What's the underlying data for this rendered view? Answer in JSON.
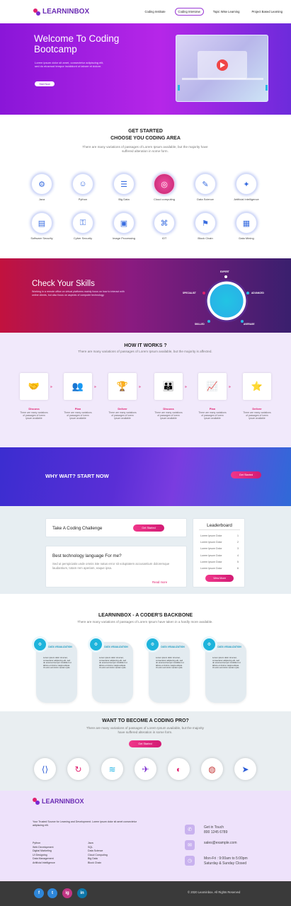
{
  "brand": {
    "name": "LEARNINBOX",
    "accent": "#9b2ee0",
    "pink": "#e0206f"
  },
  "nav": {
    "items": [
      "Coding Institute",
      "Coding Interview",
      "Topic Wise Learning",
      "Project Based Learning"
    ],
    "active_index": 1
  },
  "hero": {
    "title": "Welcome To Coding Bootcamp",
    "text": "Lorem ipsum dolor sit amet, consectetur adipiscing elit, sed do eiusmod tempor incididunt ut labore et dolore.",
    "button": "Start Now"
  },
  "get_started": {
    "title": "GET STARTED",
    "subtitle": "CHOOSE YOU CODING AREA",
    "desc": "There are many variations of passages of Lorem Ipsum available, but the majority have suffered alteration in some form.",
    "areas": [
      {
        "label": "Java",
        "icon": "brain-chip-icon"
      },
      {
        "label": "Python",
        "icon": "person-icon"
      },
      {
        "label": "Big Data",
        "icon": "database-icon"
      },
      {
        "label": "Cloud computing",
        "icon": "target-icon"
      },
      {
        "label": "Data Science",
        "icon": "blueprint-icon"
      },
      {
        "label": "Artificial Intelligence",
        "icon": "ai-head-icon"
      },
      {
        "label": "Software Security",
        "icon": "document-icon"
      },
      {
        "label": "Cyber Security",
        "icon": "user-lock-icon"
      },
      {
        "label": "Image Processing",
        "icon": "briefcase-icon"
      },
      {
        "label": "IOT",
        "icon": "circuit-icon"
      },
      {
        "label": "Block Chain",
        "icon": "network-icon"
      },
      {
        "label": "Data Mining",
        "icon": "folders-icon"
      }
    ]
  },
  "skills": {
    "title": "Check Your Skills",
    "text": "Working in a remote office on virtual platforms mainly focus on how to interact with online clients, but also focus on aspects of computer technology.",
    "dial_labels": [
      "EXPERT",
      "SPECIALIST",
      "ADVANCED",
      "SKILLED",
      "AVERAGE"
    ]
  },
  "how": {
    "title": "HOW IT WORKS ?",
    "desc": "There are many variations of passages of Lorem Ipsum available, but the majority is affected.",
    "steps": [
      {
        "title": "Discuss",
        "text": "There are many variations of passages of lorem ipsum available",
        "icon": "handshake-icon"
      },
      {
        "title": "Plan",
        "text": "There are many variations of passages of lorem ipsum available",
        "icon": "meeting-icon"
      },
      {
        "title": "Deliver",
        "text": "There are many variations of passages of lorem ipsum available",
        "icon": "podium-icon"
      },
      {
        "title": "Discuss",
        "text": "There are many variations of passages of lorem ipsum available",
        "icon": "team-icon"
      },
      {
        "title": "Plan",
        "text": "There are many variations of passages of lorem ipsum available",
        "icon": "presenter-icon"
      },
      {
        "title": "Deliver",
        "text": "There are many variations of passages of lorem ipsum available",
        "icon": "group-icon"
      }
    ]
  },
  "wait": {
    "title": "WHY WAIT? START NOW",
    "button": "Get Started"
  },
  "challenge": {
    "title": "Take A Coding Challenge",
    "button": "Get Started",
    "question": "Best technology language For me?",
    "question_text": "Sed ut perspiciatis unde omnis iste natus error sit voluptatem accusantium doloremque laudantium, totam rem aperiam, eaque ipsa.",
    "read_more": "Read more",
    "leaderboard_title": "Leaderboard",
    "leaderboard": [
      {
        "name": "Lorem Ipsum Dolor",
        "rank": "1"
      },
      {
        "name": "Lorem Ipsum Dolor",
        "rank": "2"
      },
      {
        "name": "Lorem Ipsum Dolor",
        "rank": "3"
      },
      {
        "name": "Lorem Ipsum Dolor",
        "rank": "4"
      },
      {
        "name": "Lorem Ipsum Dolor",
        "rank": "5"
      },
      {
        "name": "Lorem Ipsum Dolor",
        "rank": "6"
      }
    ],
    "view_more": "View More"
  },
  "backbone": {
    "title": "LEARNINBOX - A CODER'S BACKBONE",
    "desc": "There are many variations of passages of Lorem Ipsum have taken in a hardly more available.",
    "cards": [
      {
        "head": "DATA VISUALIZATION",
        "text": "Lorem ipsum dolor sit amet, consectetur adipiscing elit, sed do eiusmod tempor incididunt ut labore et dolore magna aliqua. Ut enim ad minim veniam quis."
      },
      {
        "head": "DATA VISUALIZATION",
        "text": "Lorem ipsum dolor sit amet, consectetur adipiscing elit, sed do eiusmod tempor incididunt ut labore et dolore magna aliqua. Ut enim ad minim veniam quis."
      },
      {
        "head": "DATA VISUALIZATION",
        "text": "Lorem ipsum dolor sit amet, consectetur adipiscing elit, sed do eiusmod tempor incididunt ut labore et dolore magna aliqua. Ut enim ad minim veniam quis."
      },
      {
        "head": "DATA VISUALIZATION",
        "text": "Lorem ipsum dolor sit amet, consectetur adipiscing elit, sed do eiusmod tempor incididunt ut labore et dolore magna aliqua. Ut enim ad minim veniam quis."
      }
    ]
  },
  "pro": {
    "title": "WANT TO BECOME A CODING PRO?",
    "desc": "There are many variations of passages of Lorem Ipsum available, but the majority have suffered alteration in some form.",
    "button": "Get Started",
    "techs": [
      "code-icon",
      "refresh-icon",
      "layers-icon",
      "bird-icon",
      "rainbow-icon",
      "globe-icon",
      "arrow-icon"
    ]
  },
  "footer": {
    "brand": "LEARNINBOX",
    "text": "Your Trusted Source for Learning and Development. Lorem ipsum dolor sit amet consectetur adipiscing elit.",
    "col1": [
      "Python",
      "Web Development",
      "Digital Marketing",
      "UI Designing",
      "Data Management",
      "Artificial Intelligence"
    ],
    "col2": [
      "Java",
      "SQL",
      "Data Science",
      "Cloud Computing",
      "Big Data",
      "Block Chain"
    ],
    "contact": [
      {
        "icon": "phone-icon",
        "line1": "Get in Touch",
        "line2": "800 1245 6789"
      },
      {
        "icon": "mail-icon",
        "line1": "sales@example.com",
        "line2": ""
      },
      {
        "icon": "clock-icon",
        "line1": "Mon-Fri : 9:00am to 5:00pm",
        "line2": "Saturday & Sunday Closed"
      }
    ],
    "copyright": "© 2020 Learninbox. All Rights Reserved",
    "social": [
      "f",
      "t",
      "ig",
      "in"
    ]
  }
}
